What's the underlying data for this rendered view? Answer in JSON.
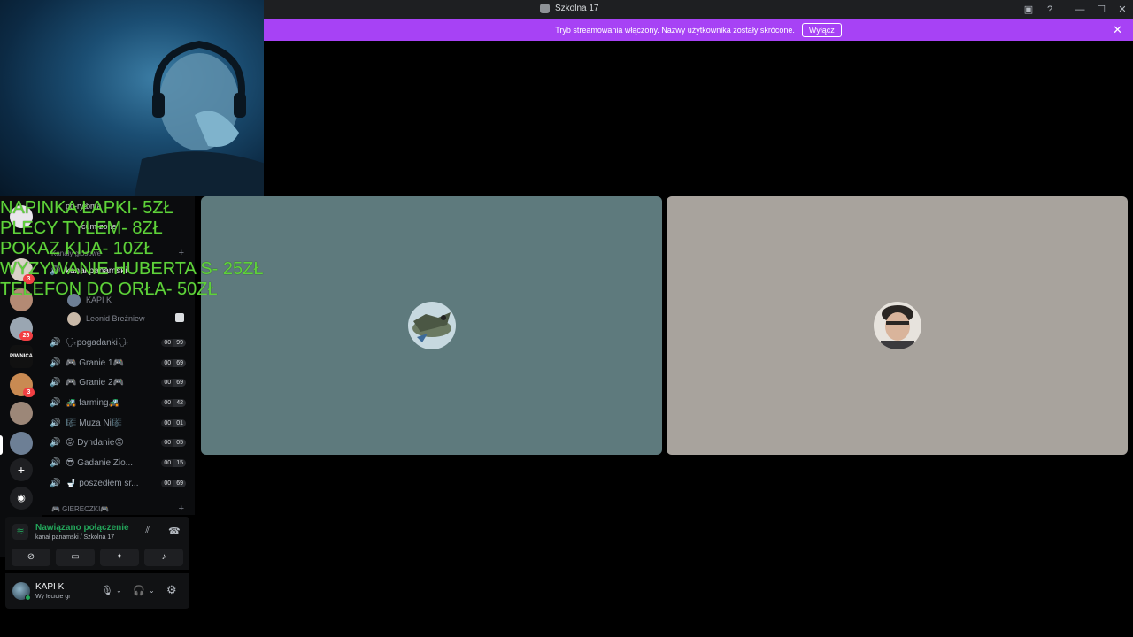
{
  "titlebar": {
    "title": "Szkolna 17",
    "icons": [
      "inbox-icon",
      "help-icon",
      "minimize-icon",
      "maximize-icon",
      "close-icon"
    ]
  },
  "banner": {
    "text": "Tryb streamowania włączony. Nazwy użytkownika zostały skrócone.",
    "button": "Wyłącz",
    "color": "#a742f5"
  },
  "overlay": {
    "lines": [
      "NAPINKA ŁAPKI- 5ZŁ",
      "PLECY TYLEM- 8ZŁ",
      "POKAZ KIJA- 10ZŁ",
      "WYZYWANIE HUBERTA S- 25ZŁ",
      "TELEFON DO ORŁA- 50ZŁ"
    ],
    "color": "#5fd23a"
  },
  "rail": {
    "badges": [
      "3",
      "26",
      "3"
    ],
    "pwnica_label": "PIWNICA"
  },
  "sidebar": {
    "text_channels": [
      "po-rytbma",
      "cum-zone"
    ],
    "voice_category": "Kanały głosowe",
    "current_channel": "kanał panamski",
    "current_users": [
      "KAPI K",
      "Leonid Breżniew"
    ],
    "voice_channels": [
      {
        "name": "🗣pogadanki🗣",
        "a": "00",
        "b": "99"
      },
      {
        "name": "🎮 Granie 1🎮",
        "a": "00",
        "b": "69"
      },
      {
        "name": "🎮 Granie 2🎮",
        "a": "00",
        "b": "69"
      },
      {
        "name": "🚜 farming🚜",
        "a": "00",
        "b": "42"
      },
      {
        "name": "🎼 Muza Ni🎼",
        "a": "00",
        "b": "01"
      },
      {
        "name": "😡 Dyndanie😡",
        "a": "00",
        "b": "05"
      },
      {
        "name": "😎 Gadanie Zio...",
        "a": "00",
        "b": "15"
      },
      {
        "name": "🚽 poszedłem sr...",
        "a": "00",
        "b": "69"
      }
    ],
    "games_category": "🎮 GIERECZKI🎮"
  },
  "voice_panel": {
    "status": "Nawiązano połączenie",
    "sub": "kanał panamski / Szkolna 17",
    "buttons": [
      "camera-off-icon",
      "screen-share-icon",
      "activity-icon",
      "soundboard-icon"
    ]
  },
  "user_panel": {
    "name": "KAPI K",
    "status": "Wy lecicie gr"
  },
  "tiles": {
    "left_color": "#5e7a7d",
    "right_color": "#a8a39d"
  }
}
